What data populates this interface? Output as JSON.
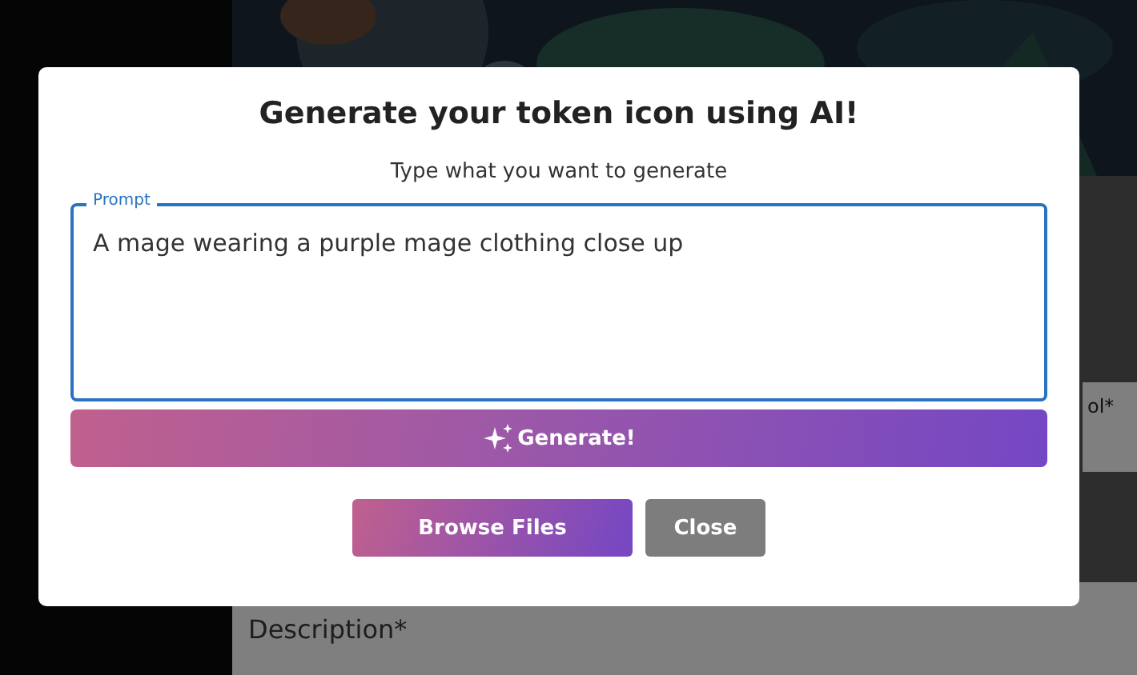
{
  "background": {
    "partial_field_label": "ol*",
    "description_field": {
      "placeholder": "Description*"
    }
  },
  "dialog": {
    "title": "Generate your token icon using AI!",
    "subtitle": "Type what you want to generate",
    "prompt": {
      "label": "Prompt",
      "value": "A mage wearing a purple mage clothing close up",
      "focused": true
    },
    "generate_button": {
      "label": "Generate!"
    },
    "buttons": [
      {
        "label": "Browse Files",
        "kind": "primary"
      },
      {
        "label": "Close",
        "kind": "secondary"
      }
    ]
  }
}
